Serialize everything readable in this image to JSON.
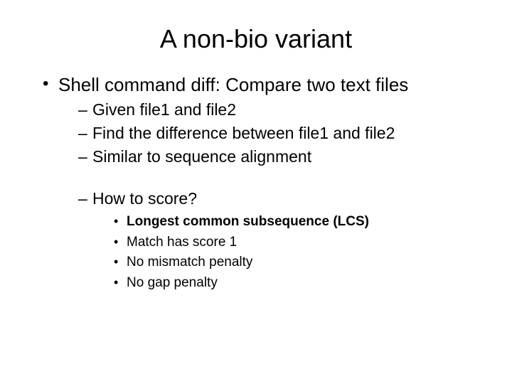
{
  "title": "A non-bio variant",
  "bullets": {
    "main": "Shell command diff: Compare two text files",
    "sub": [
      "Given file1 and file2",
      "Find the difference between file1 and file2",
      "Similar to sequence alignment"
    ],
    "question": "How to score?",
    "details": [
      "Longest common subsequence (LCS)",
      "Match has score 1",
      "No mismatch penalty",
      "No gap penalty"
    ]
  }
}
